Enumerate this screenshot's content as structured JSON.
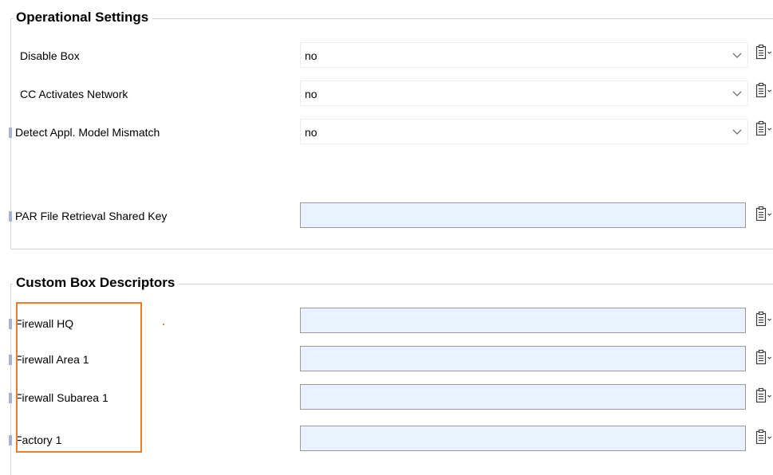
{
  "operational_settings": {
    "title": "Operational Settings",
    "rows": [
      {
        "label": "Disable Box",
        "value": "no"
      },
      {
        "label": "CC Activates Network",
        "value": "no"
      },
      {
        "label": "Detect Appl. Model Mismatch",
        "value": "no"
      }
    ],
    "par_key": {
      "label": "PAR File Retrieval Shared Key",
      "value": ""
    }
  },
  "custom_box_descriptors": {
    "title": "Custom Box Descriptors",
    "rows": [
      {
        "label": "Firewall HQ",
        "value": ""
      },
      {
        "label": "Firewall Area 1",
        "value": ""
      },
      {
        "label": "Firewall Subarea 1",
        "value": ""
      },
      {
        "label": "Factory 1",
        "value": ""
      }
    ]
  },
  "icons": {
    "clipboard": "clipboard-icon",
    "dropdown": "chevron-down-icon",
    "modified_marker": "modified-marker-icon"
  },
  "colors": {
    "input_background": "#e9f2fe",
    "modified_marker": "#a6b2d3",
    "highlight": "#f07c26",
    "frame_border": "#d4d4d4"
  }
}
